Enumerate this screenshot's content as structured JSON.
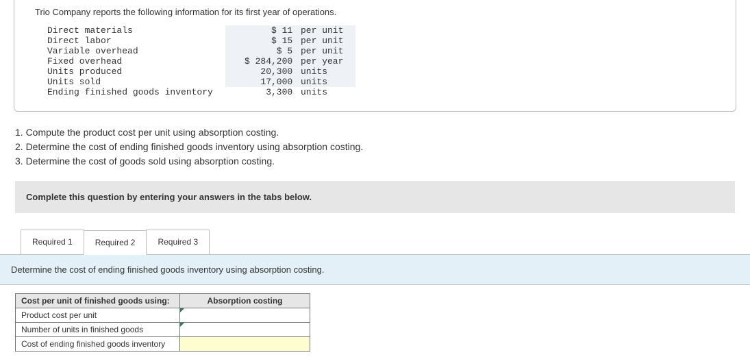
{
  "intro": "Trio Company reports the following information for its first year of operations.",
  "rows": [
    {
      "label": "Direct materials",
      "value": "$ 11",
      "unit": "per unit",
      "hl": true
    },
    {
      "label": "Direct labor",
      "value": "$ 15",
      "unit": "per unit",
      "hl": true
    },
    {
      "label": "Variable overhead",
      "value": "$ 5",
      "unit": "per unit",
      "hl": true
    },
    {
      "label": "Fixed overhead",
      "value": "$ 284,200",
      "unit": "per year",
      "hl": true
    },
    {
      "label": "Units produced",
      "value": "20,300",
      "unit": "units",
      "hl": true
    },
    {
      "label": "Units sold",
      "value": "17,000",
      "unit": "units",
      "hl": true
    },
    {
      "label": "Ending finished goods inventory",
      "value": "3,300",
      "unit": "units",
      "hl": false
    }
  ],
  "questions": {
    "q1": "1. Compute the product cost per unit using absorption costing.",
    "q2": "2. Determine the cost of ending finished goods inventory using absorption costing.",
    "q3": "3. Determine the cost of goods sold using absorption costing."
  },
  "instruction": "Complete this question by entering your answers in the tabs below.",
  "tabs": {
    "t1": "Required 1",
    "t2": "Required 2",
    "t3": "Required 3"
  },
  "tabPrompt": "Determine the cost of ending finished goods inventory using absorption costing.",
  "table": {
    "h1": "Cost per unit of finished goods using:",
    "h2": "Absorption costing",
    "r1": "Product cost per unit",
    "r2": "Number of units in finished goods",
    "r3": "Cost of ending finished goods inventory"
  }
}
